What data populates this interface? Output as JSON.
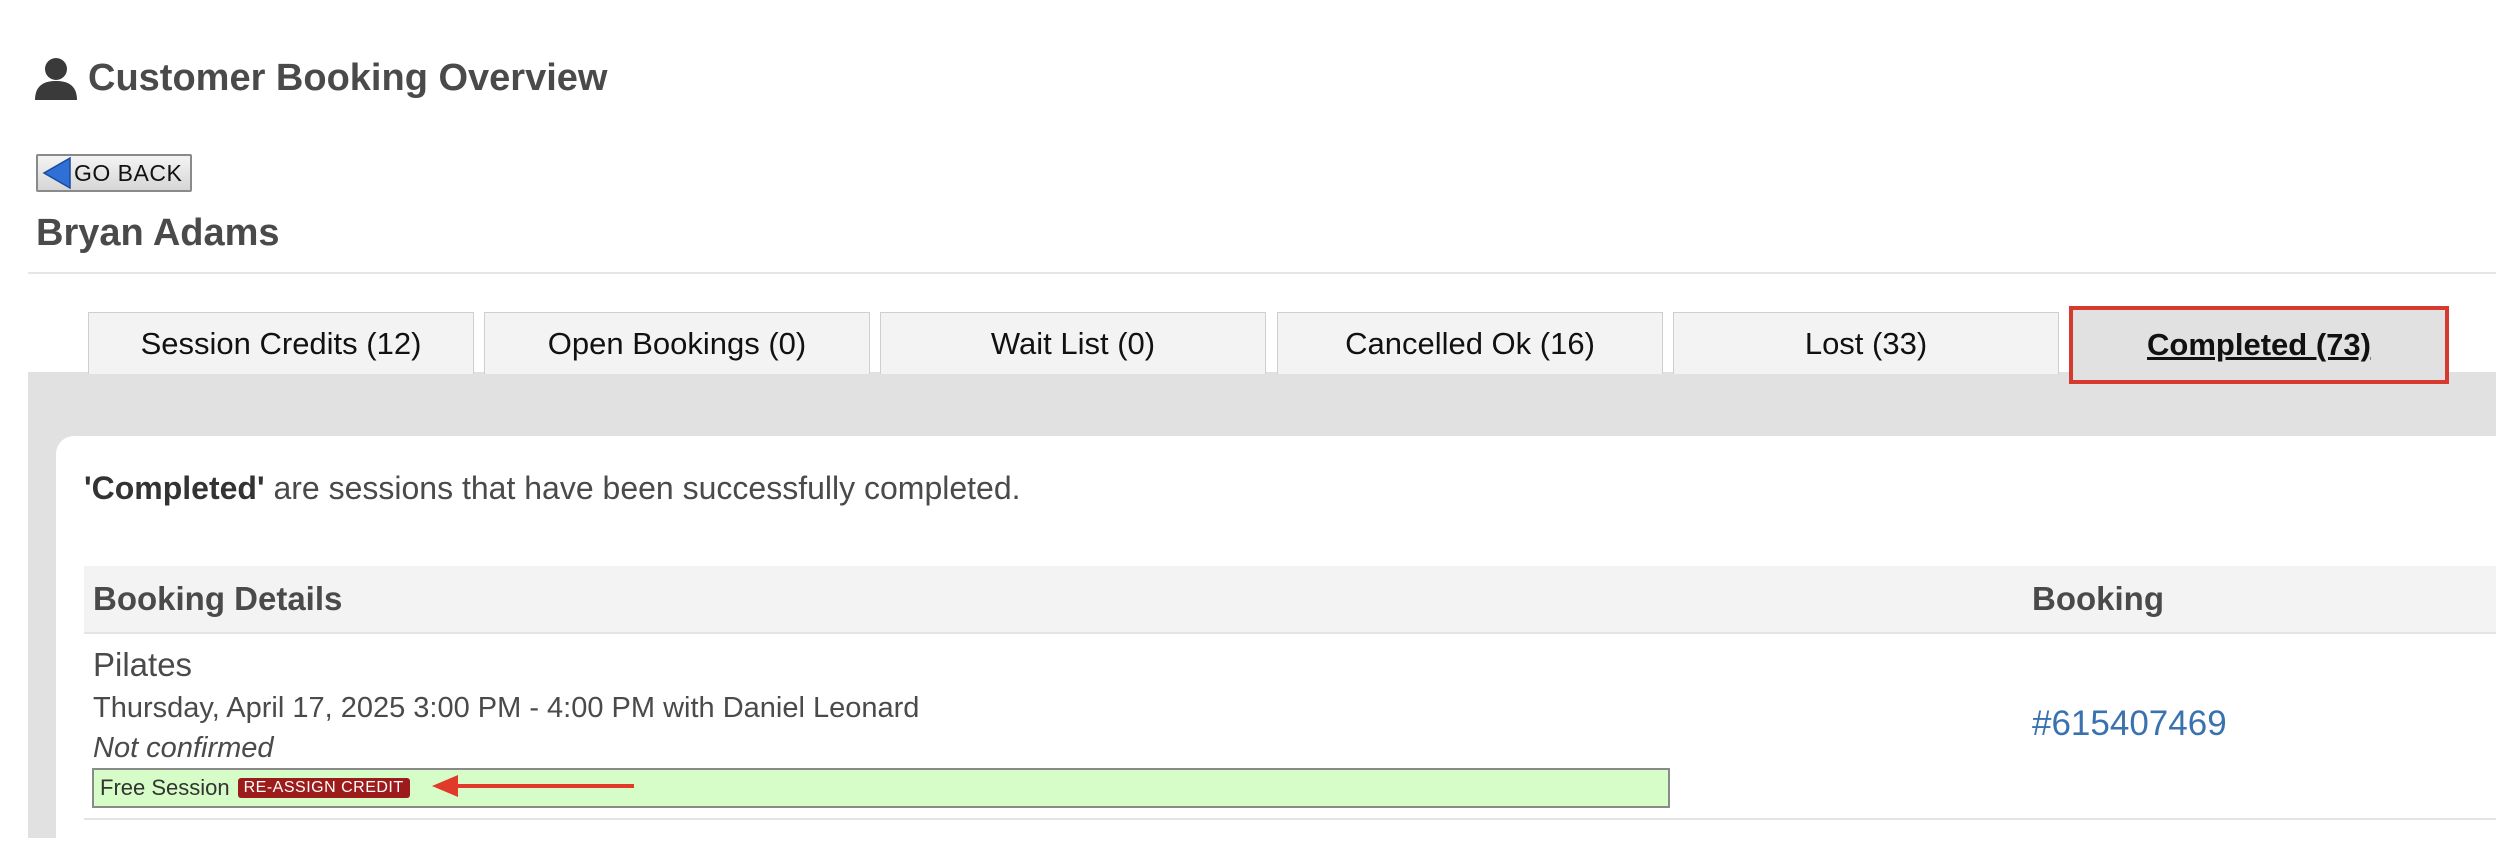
{
  "header": {
    "title": "Customer Booking Overview",
    "icon": "person-icon"
  },
  "go_back": {
    "label": "GO BACK",
    "icon": "back-arrow-icon"
  },
  "customer": {
    "name": "Bryan Adams"
  },
  "tabs": [
    {
      "label": "Session Credits (12)",
      "active": false
    },
    {
      "label": "Open Bookings (0)",
      "active": false
    },
    {
      "label": "Wait List (0)",
      "active": false
    },
    {
      "label": "Cancelled Ok (16)",
      "active": false
    },
    {
      "label": "Lost (33)",
      "active": false
    },
    {
      "label": "Completed (73)",
      "active": true
    }
  ],
  "panel": {
    "intro_bold": "'Completed'",
    "intro_rest": " are sessions that have been successfully completed."
  },
  "table": {
    "headers": {
      "details": "Booking Details",
      "booking": "Booking"
    },
    "rows": [
      {
        "session": "Pilates",
        "when": "Thursday, April 17, 2025 3:00 PM - 4:00 PM with Daniel Leonard",
        "status": "Not confirmed",
        "credit_label": "Free Session",
        "credit_action": "RE-ASSIGN CREDIT",
        "booking_ref": "#615407469"
      }
    ]
  },
  "colors": {
    "active_tab_outline": "#d63a2e",
    "credit_bar": "#d6fcc7",
    "reassign_badge": "#9c1c1c",
    "link": "#3a72b0",
    "annotation_arrow": "#e23a2a"
  }
}
